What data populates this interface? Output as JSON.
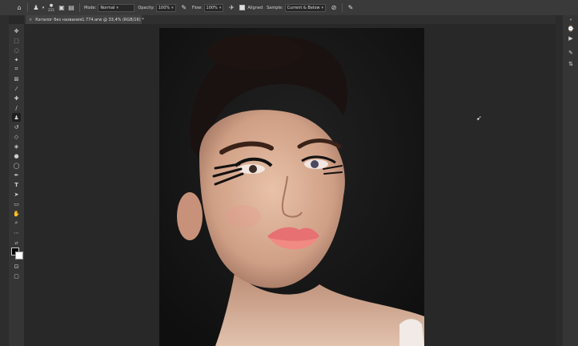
{
  "options_bar": {
    "mode_label": "Mode:",
    "mode_value": "Normal",
    "opacity_label": "Opacity:",
    "opacity_value": "100%",
    "flow_label": "Flow:",
    "flow_value": "100%",
    "aligned_label": "Aligned",
    "sample_label": "Sample:",
    "sample_value": "Current & Below",
    "brush_size": "215"
  },
  "document_tab": {
    "title": "Каталог без названия1.774.arw @ 33,4% (RGB/16) *",
    "close": "×"
  },
  "icons": {
    "home": "home-icon",
    "tool": "clone-stamp-icon",
    "panel_expand": "chevrons-icon"
  }
}
